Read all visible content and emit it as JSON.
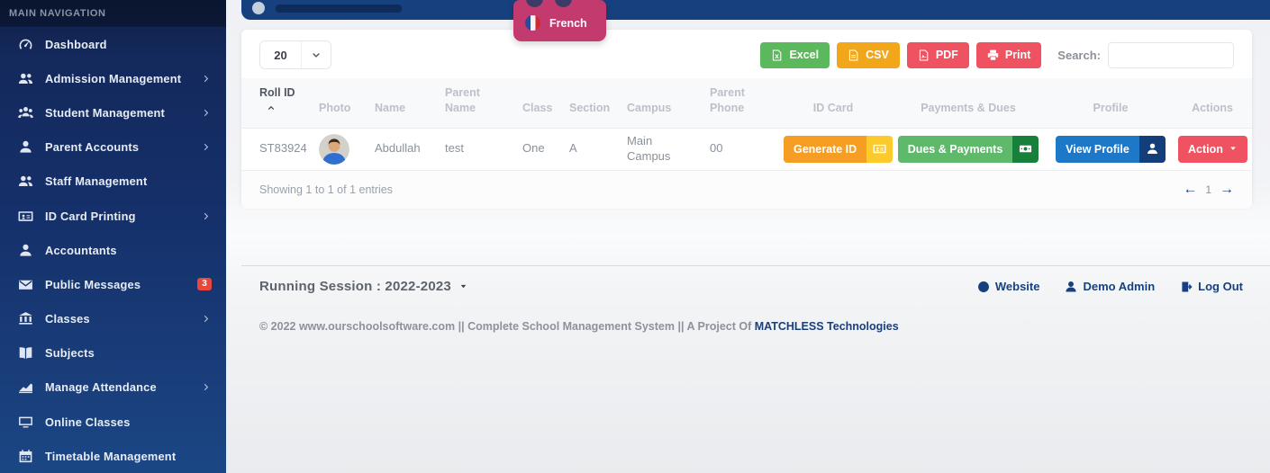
{
  "colors": {
    "sidebar_navy": "#15306a",
    "topbar_navy": "#17407e",
    "dropdown_pink": "#c23a6e",
    "excel_green": "#5cb85c",
    "csv_orange": "#f2a71b",
    "pdf_red": "#ef5361",
    "print_red": "#ef5361",
    "generate_id_orange": "#f59e23",
    "generate_id_segment": "#fcca2a",
    "dues_green": "#5eb96b",
    "dues_segment": "#17813c",
    "profile_blue": "#1e78c8",
    "profile_segment": "#143e79",
    "action_red": "#ef5361",
    "badge_red": "#e8483c"
  },
  "sidebar": {
    "header": "MAIN NAVIGATION",
    "items": [
      {
        "label": "Dashboard",
        "icon": "gauge-icon",
        "chevron": false
      },
      {
        "label": "Admission Management",
        "icon": "users-icon",
        "chevron": true
      },
      {
        "label": "Student Management",
        "icon": "students-icon",
        "chevron": true
      },
      {
        "label": "Parent Accounts",
        "icon": "user-icon",
        "chevron": true
      },
      {
        "label": "Staff Management",
        "icon": "users-icon",
        "chevron": false
      },
      {
        "label": "ID Card Printing",
        "icon": "id-card-icon",
        "chevron": true
      },
      {
        "label": "Accountants",
        "icon": "user-icon",
        "chevron": false
      },
      {
        "label": "Public Messages",
        "icon": "envelope-icon",
        "chevron": false,
        "badge": "3"
      },
      {
        "label": "Classes",
        "icon": "bank-icon",
        "chevron": true
      },
      {
        "label": "Subjects",
        "icon": "book-icon",
        "chevron": false
      },
      {
        "label": "Manage Attendance",
        "icon": "chart-icon",
        "chevron": true
      },
      {
        "label": "Online Classes",
        "icon": "monitor-icon",
        "chevron": false
      },
      {
        "label": "Timetable Management",
        "icon": "calendar-icon",
        "chevron": false
      }
    ]
  },
  "language_dropdown": {
    "items": [
      {
        "label": "French",
        "icon": "french-flag-icon"
      }
    ]
  },
  "toolbar": {
    "page_size": "20",
    "export_buttons": [
      {
        "label": "Excel",
        "icon": "file-excel-icon",
        "color": "#5cb85c"
      },
      {
        "label": "CSV",
        "icon": "file-csv-icon",
        "color": "#f2a71b"
      },
      {
        "label": "PDF",
        "icon": "file-pdf-icon",
        "color": "#ef5361"
      },
      {
        "label": "Print",
        "icon": "printer-icon",
        "color": "#ef5361"
      }
    ],
    "search_label": "Search:",
    "search_value": ""
  },
  "table": {
    "columns": [
      "Roll ID",
      "Photo",
      "Name",
      "Parent Name",
      "Class",
      "Section",
      "Campus",
      "Parent Phone",
      "ID Card",
      "Payments & Dues",
      "Profile",
      "Actions"
    ],
    "sorted_column": "Roll ID",
    "row": {
      "roll_id": "ST83924",
      "name": "Abdullah",
      "parent_name": "test",
      "class": "One",
      "section": "A",
      "campus": "Main Campus",
      "parent_phone": "00",
      "id_card_button": "Generate ID",
      "payments_button": "Dues & Payments",
      "profile_button": "View Profile",
      "action_button": "Action"
    },
    "summary": "Showing 1 to 1 of 1 entries",
    "pagination": {
      "prev": "←",
      "page": "1",
      "next": "→"
    }
  },
  "footer": {
    "session_label": "Running Session : 2022-2023",
    "links": [
      {
        "label": "Website",
        "icon": "globe-icon"
      },
      {
        "label": "Demo Admin",
        "icon": "user-icon"
      },
      {
        "label": "Log Out",
        "icon": "logout-icon"
      }
    ],
    "copyright_prefix": "© 2022 www.ourschoolsoftware.com || Complete School Management System || A Project Of ",
    "copyright_brand": "MATCHLESS Technologies"
  }
}
